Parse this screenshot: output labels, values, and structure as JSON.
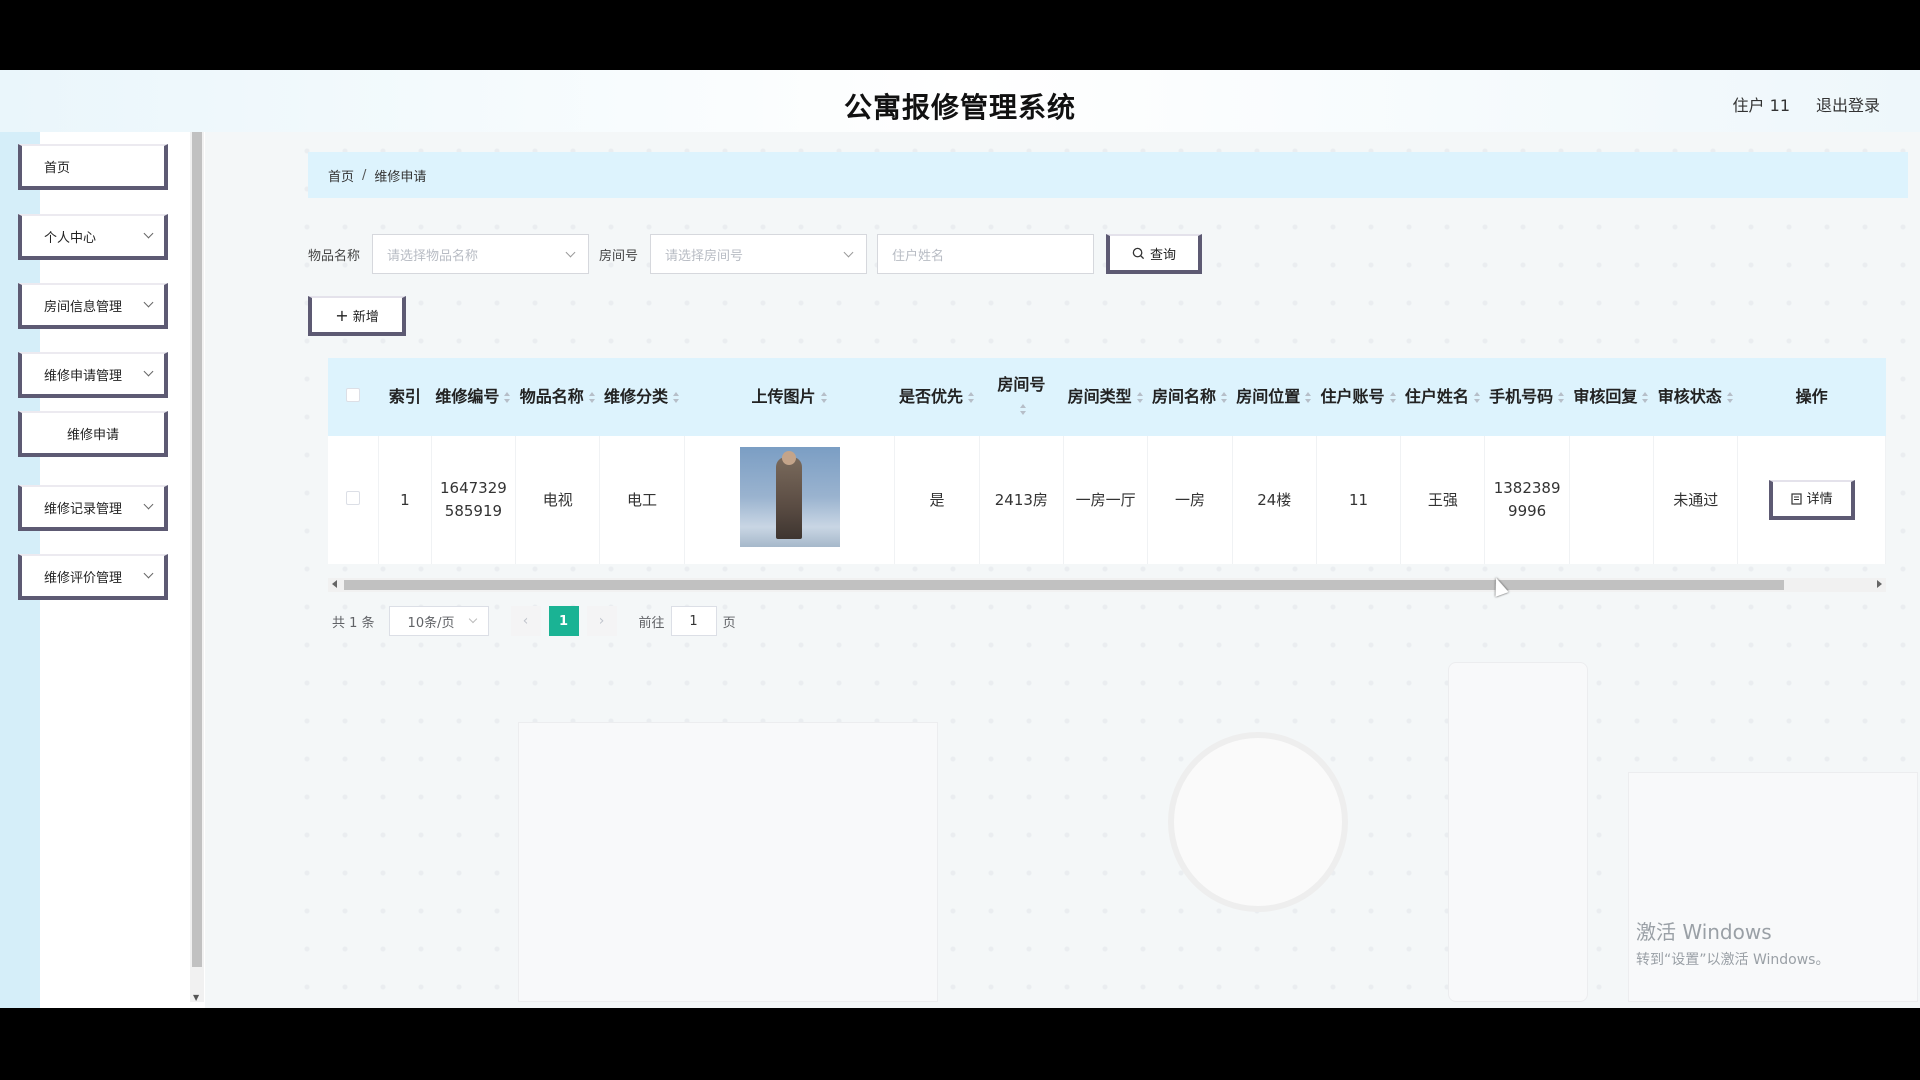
{
  "header": {
    "title": "公寓报修管理系统",
    "user": "住户 11",
    "logout": "退出登录"
  },
  "sidebar": {
    "items": [
      {
        "label": "首页"
      },
      {
        "label": "个人中心"
      },
      {
        "label": "房间信息管理"
      },
      {
        "label": "维修申请管理"
      },
      {
        "label": "维修申请"
      },
      {
        "label": "维修记录管理"
      },
      {
        "label": "维修评价管理"
      }
    ]
  },
  "breadcrumb": {
    "home": "首页",
    "separator": "/",
    "current": "维修申请"
  },
  "filters": {
    "item_label": "物品名称",
    "item_placeholder": "请选择物品名称",
    "room_label": "房间号",
    "room_placeholder": "请选择房间号",
    "name_placeholder": "住户姓名",
    "query_label": "查询"
  },
  "actions": {
    "add_label": "新增"
  },
  "table": {
    "headers": {
      "index": "索引",
      "repair_no": "维修编号",
      "item_name": "物品名称",
      "category": "维修分类",
      "image": "上传图片",
      "priority": "是否优先",
      "room_no": "房间号",
      "room_type": "房间类型",
      "room_name": "房间名称",
      "room_location": "房间位置",
      "account": "住户账号",
      "resident_name": "住户姓名",
      "phone": "手机号码",
      "review_reply": "审核回复",
      "review_status": "审核状态",
      "operation": "操作"
    },
    "rows": [
      {
        "index": "1",
        "repair_no": "1647329585919",
        "item_name": "电视",
        "category": "电工",
        "priority": "是",
        "room_no": "2413房",
        "room_type": "一房一厅",
        "room_name": "一房",
        "room_location": "24楼",
        "account": "11",
        "resident_name": "王强",
        "phone": "13823899996",
        "review_reply": "",
        "review_status": "未通过",
        "detail_label": "详情"
      }
    ]
  },
  "pagination": {
    "total": "共 1 条",
    "page_size": "10条/页",
    "current_page": "1",
    "goto_prefix": "前往",
    "goto_value": "1",
    "goto_suffix": "页"
  },
  "watermark": {
    "line1": "激活 Windows",
    "line2": "转到“设置”以激活 Windows。"
  },
  "colors": {
    "accent": "#1ab394",
    "header_bg": "#ddf3fd",
    "button_border": "#5d5a73"
  }
}
